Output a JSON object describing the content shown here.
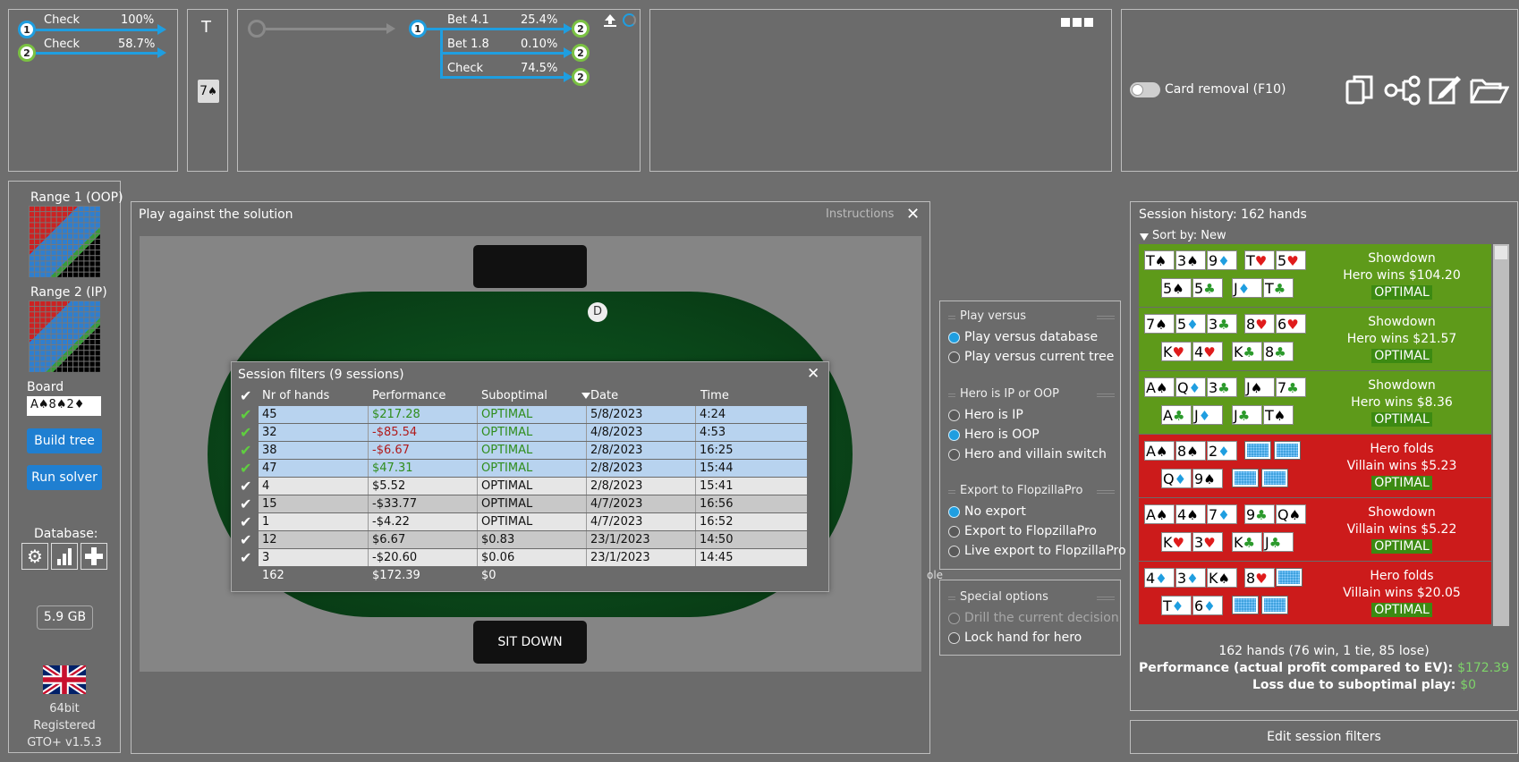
{
  "top": {
    "strategy": [
      {
        "node": "1",
        "label": "Check",
        "pct": "100%"
      },
      {
        "node": "2",
        "label": "Check",
        "pct": "58.7%"
      }
    ],
    "turn_label": "T",
    "turn_card": {
      "rank": "7",
      "suit": "♠"
    },
    "tree": {
      "root_node": "1",
      "actions": [
        {
          "label": "Bet 4.1",
          "pct": "25.4%",
          "node": "2"
        },
        {
          "label": "Bet 1.8",
          "pct": "0.10%",
          "node": "2"
        },
        {
          "label": "Check",
          "pct": "74.5%",
          "node": "2"
        }
      ]
    },
    "card_removal_label": "Card removal (F10)",
    "icons": [
      "copy-icon",
      "tree-icon",
      "edit-icon",
      "folder-icon"
    ]
  },
  "sidebar": {
    "range1_label": "Range 1 (OOP)",
    "range2_label": "Range 2 (IP)",
    "board_label": "Board",
    "board_value": "A♠8♠2♦",
    "build_tree": "Build tree",
    "run_solver": "Run solver",
    "database_label": "Database:",
    "memory": "5.9 GB",
    "arch": "64bit",
    "registered": "Registered",
    "version": "GTO+ v1.5.3"
  },
  "play": {
    "title": "Play against the solution",
    "instructions": "Instructions",
    "dealer": "D",
    "sit_down": "SIT DOWN",
    "behind_text": "ole"
  },
  "filters": {
    "title": "Session filters (9 sessions)",
    "columns": [
      "Nr of hands",
      "Performance",
      "Suboptimal",
      "Date",
      "Time"
    ],
    "rows": [
      {
        "hands": "45",
        "perf": "$217.28",
        "sub": "OPTIMAL",
        "date": "5/8/2023",
        "time": "4:24",
        "style": "blue",
        "perf_color": "green",
        "sub_color": "green",
        "check": "green"
      },
      {
        "hands": "32",
        "perf": "-$85.54",
        "sub": "OPTIMAL",
        "date": "4/8/2023",
        "time": "4:53",
        "style": "blue",
        "perf_color": "red",
        "sub_color": "green",
        "check": "green"
      },
      {
        "hands": "38",
        "perf": "-$6.67",
        "sub": "OPTIMAL",
        "date": "2/8/2023",
        "time": "16:25",
        "style": "blue",
        "perf_color": "red",
        "sub_color": "green",
        "check": "green"
      },
      {
        "hands": "47",
        "perf": "$47.31",
        "sub": "OPTIMAL",
        "date": "2/8/2023",
        "time": "15:44",
        "style": "blue",
        "perf_color": "green",
        "sub_color": "green",
        "check": "green"
      },
      {
        "hands": "4",
        "perf": "$5.52",
        "sub": "OPTIMAL",
        "date": "2/8/2023",
        "time": "15:41",
        "style": "light",
        "perf_color": "plain",
        "sub_color": "plain",
        "check": "white"
      },
      {
        "hands": "15",
        "perf": "-$33.77",
        "sub": "OPTIMAL",
        "date": "4/7/2023",
        "time": "16:56",
        "style": "dark",
        "perf_color": "plain",
        "sub_color": "plain",
        "check": "white"
      },
      {
        "hands": "1",
        "perf": "-$4.22",
        "sub": "OPTIMAL",
        "date": "4/7/2023",
        "time": "16:52",
        "style": "light",
        "perf_color": "plain",
        "sub_color": "plain",
        "check": "white"
      },
      {
        "hands": "12",
        "perf": "$6.67",
        "sub": "$0.83",
        "date": "23/1/2023",
        "time": "14:50",
        "style": "dark",
        "perf_color": "plain",
        "sub_color": "plain",
        "check": "white"
      },
      {
        "hands": "3",
        "perf": "-$20.60",
        "sub": "$0.06",
        "date": "23/1/2023",
        "time": "14:45",
        "style": "light",
        "perf_color": "plain",
        "sub_color": "plain",
        "check": "white"
      }
    ],
    "totals": {
      "hands": "162",
      "perf": "$172.39",
      "sub": "$0"
    }
  },
  "options": {
    "play_versus_title": "Play versus",
    "play_versus": [
      {
        "label": "Play versus database",
        "on": true
      },
      {
        "label": "Play versus current tree",
        "on": false
      }
    ],
    "hero_title": "Hero is IP or OOP",
    "hero": [
      {
        "label": "Hero is IP",
        "on": false
      },
      {
        "label": "Hero is OOP",
        "on": true
      },
      {
        "label": "Hero and villain switch",
        "on": false
      }
    ],
    "export_title": "Export to FlopzillaPro",
    "export": [
      {
        "label": "No export",
        "on": true
      },
      {
        "label": "Export to FlopzillaPro",
        "on": false
      },
      {
        "label": "Live export to FlopzillaPro",
        "on": false
      }
    ],
    "special_title": "Special options",
    "special": [
      {
        "label": "Drill the current decision",
        "on": false,
        "disabled": true
      },
      {
        "label": "Lock hand for hero",
        "on": false,
        "disabled": false
      }
    ]
  },
  "history": {
    "title": "Session history: 162 hands",
    "sort": "Sort by: New",
    "rows": [
      {
        "color": "#5e9a1a",
        "line1": "Showdown",
        "line2": "Hero wins $104.20",
        "line3": "OPTIMAL",
        "top": [
          {
            "r": "T",
            "s": "♠",
            "c": "#000"
          },
          {
            "r": "3",
            "s": "♠",
            "c": "#000"
          },
          {
            "r": "9",
            "s": "♦",
            "c": "#1f9ee0"
          },
          {
            "r": "T",
            "s": "♥",
            "c": "#e01b1b"
          },
          {
            "r": "5",
            "s": "♥",
            "c": "#e01b1b"
          }
        ],
        "bottom": [
          {
            "r": "5",
            "s": "♠",
            "c": "#000"
          },
          {
            "r": "5",
            "s": "♣",
            "c": "#2c9a2c"
          },
          {
            "r": "J",
            "s": "♦",
            "c": "#1f9ee0"
          },
          {
            "r": "T",
            "s": "♣",
            "c": "#2c9a2c"
          }
        ]
      },
      {
        "color": "#5e9a1a",
        "line1": "Showdown",
        "line2": "Hero wins $21.57",
        "line3": "OPTIMAL",
        "top": [
          {
            "r": "7",
            "s": "♠",
            "c": "#000"
          },
          {
            "r": "5",
            "s": "♦",
            "c": "#1f9ee0"
          },
          {
            "r": "3",
            "s": "♣",
            "c": "#2c9a2c"
          },
          {
            "r": "8",
            "s": "♥",
            "c": "#e01b1b"
          },
          {
            "r": "6",
            "s": "♥",
            "c": "#e01b1b"
          }
        ],
        "bottom": [
          {
            "r": "K",
            "s": "♥",
            "c": "#e01b1b"
          },
          {
            "r": "4",
            "s": "♥",
            "c": "#e01b1b"
          },
          {
            "r": "K",
            "s": "♣",
            "c": "#2c9a2c"
          },
          {
            "r": "8",
            "s": "♣",
            "c": "#2c9a2c"
          }
        ]
      },
      {
        "color": "#5e9a1a",
        "line1": "Showdown",
        "line2": "Hero wins $8.36",
        "line3": "OPTIMAL",
        "top": [
          {
            "r": "A",
            "s": "♠",
            "c": "#000"
          },
          {
            "r": "Q",
            "s": "♦",
            "c": "#1f9ee0"
          },
          {
            "r": "3",
            "s": "♣",
            "c": "#2c9a2c"
          },
          {
            "r": "J",
            "s": "♠",
            "c": "#000"
          },
          {
            "r": "7",
            "s": "♣",
            "c": "#2c9a2c"
          }
        ],
        "bottom": [
          {
            "r": "A",
            "s": "♣",
            "c": "#2c9a2c"
          },
          {
            "r": "J",
            "s": "♦",
            "c": "#1f9ee0"
          },
          {
            "r": "J",
            "s": "♣",
            "c": "#2c9a2c"
          },
          {
            "r": "T",
            "s": "♠",
            "c": "#000"
          }
        ]
      },
      {
        "color": "#cc1b1b",
        "line1": "Hero folds",
        "line2": "Villain wins $5.23",
        "line3": "OPTIMAL",
        "top": [
          {
            "r": "A",
            "s": "♠",
            "c": "#000"
          },
          {
            "r": "8",
            "s": "♠",
            "c": "#000"
          },
          {
            "r": "2",
            "s": "♦",
            "c": "#1f9ee0"
          },
          {
            "back": true
          },
          {
            "back": true
          }
        ],
        "bottom": [
          {
            "r": "Q",
            "s": "♦",
            "c": "#1f9ee0"
          },
          {
            "r": "9",
            "s": "♠",
            "c": "#000"
          },
          {
            "back": true
          },
          {
            "back": true
          }
        ]
      },
      {
        "color": "#cc1b1b",
        "line1": "Showdown",
        "line2": "Villain wins $5.22",
        "line3": "OPTIMAL",
        "top": [
          {
            "r": "A",
            "s": "♠",
            "c": "#000"
          },
          {
            "r": "4",
            "s": "♠",
            "c": "#000"
          },
          {
            "r": "7",
            "s": "♦",
            "c": "#1f9ee0"
          },
          {
            "r": "9",
            "s": "♣",
            "c": "#2c9a2c"
          },
          {
            "r": "Q",
            "s": "♠",
            "c": "#000"
          }
        ],
        "bottom": [
          {
            "r": "K",
            "s": "♥",
            "c": "#e01b1b"
          },
          {
            "r": "3",
            "s": "♥",
            "c": "#e01b1b"
          },
          {
            "r": "K",
            "s": "♣",
            "c": "#2c9a2c"
          },
          {
            "r": "J",
            "s": "♣",
            "c": "#2c9a2c"
          }
        ]
      },
      {
        "color": "#cc1b1b",
        "line1": "Hero folds",
        "line2": "Villain wins $20.05",
        "line3": "OPTIMAL",
        "top": [
          {
            "r": "4",
            "s": "♦",
            "c": "#1f9ee0"
          },
          {
            "r": "3",
            "s": "♦",
            "c": "#1f9ee0"
          },
          {
            "r": "K",
            "s": "♠",
            "c": "#000"
          },
          {
            "r": "8",
            "s": "♥",
            "c": "#e01b1b"
          },
          {
            "back": true
          }
        ],
        "bottom": [
          {
            "r": "T",
            "s": "♦",
            "c": "#1f9ee0"
          },
          {
            "r": "6",
            "s": "♦",
            "c": "#1f9ee0"
          },
          {
            "back": true
          },
          {
            "back": true
          }
        ]
      }
    ],
    "summary_hands": "162 hands (76 win, 1 tie, 85 lose)",
    "summary_perf_label": "Performance (actual profit compared to EV):",
    "summary_perf_value": "$172.39",
    "summary_loss_label": "Loss due to suboptimal play:",
    "summary_loss_value": "$0",
    "edit_filters": "Edit session filters"
  }
}
